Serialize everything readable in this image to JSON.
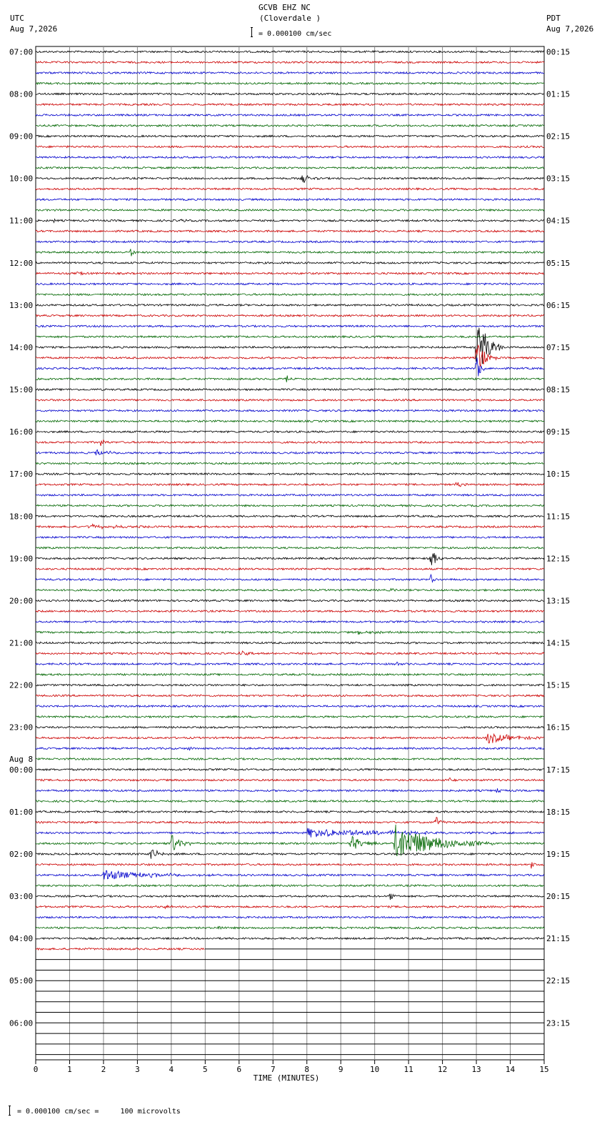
{
  "header": {
    "station": "GCVB EHZ NC",
    "location": "(Cloverdale )",
    "left_tz": "UTC",
    "left_date": "Aug 7,2026",
    "right_tz": "PDT",
    "right_date": "Aug 7,2026",
    "scale": "= 0.000100 cm/sec"
  },
  "footer": {
    "scale_note": "= 0.000100 cm/sec =     100 microvolts"
  },
  "colors": [
    "#000000",
    "#cc0000",
    "#0000cc",
    "#006600"
  ],
  "chart_data": {
    "type": "line",
    "xlabel": "TIME (MINUTES)",
    "xlim": [
      0,
      15
    ],
    "x_ticks": [
      "0",
      "1",
      "2",
      "3",
      "4",
      "5",
      "6",
      "7",
      "8",
      "9",
      "10",
      "11",
      "12",
      "13",
      "14",
      "15"
    ],
    "rows_total": 96,
    "rows_with_data": 86,
    "last_row_fraction": 0.333,
    "date_change_label": "Aug 8",
    "date_change_row": 68,
    "left_labels": [
      "07:00",
      "08:00",
      "09:00",
      "10:00",
      "11:00",
      "12:00",
      "13:00",
      "14:00",
      "15:00",
      "16:00",
      "17:00",
      "18:00",
      "19:00",
      "20:00",
      "21:00",
      "22:00",
      "23:00",
      "00:00",
      "01:00",
      "02:00",
      "03:00",
      "04:00",
      "05:00",
      "06:00"
    ],
    "right_labels": [
      "00:15",
      "01:15",
      "02:15",
      "03:15",
      "04:15",
      "05:15",
      "06:15",
      "07:15",
      "08:15",
      "09:15",
      "10:15",
      "11:15",
      "12:15",
      "13:15",
      "14:15",
      "15:15",
      "16:15",
      "17:15",
      "18:15",
      "19:15",
      "20:15",
      "21:15",
      "22:15",
      "23:15"
    ],
    "events": [
      {
        "row": 12,
        "minute": 7.85,
        "amp": 9,
        "dur": 0.5
      },
      {
        "row": 16,
        "minute": 0.55,
        "amp": 4,
        "dur": 0.1
      },
      {
        "row": 16,
        "minute": 4.3,
        "amp": 3,
        "dur": 0.3
      },
      {
        "row": 19,
        "minute": 2.8,
        "amp": 9,
        "dur": 0.2
      },
      {
        "row": 21,
        "minute": 1.2,
        "amp": 3,
        "dur": 0.5
      },
      {
        "row": 28,
        "minute": 13.0,
        "amp": 50,
        "dur": 0.8
      },
      {
        "row": 29,
        "minute": 13.0,
        "amp": 30,
        "dur": 0.6
      },
      {
        "row": 30,
        "minute": 13.0,
        "amp": 25,
        "dur": 0.3
      },
      {
        "row": 31,
        "minute": 7.4,
        "amp": 9,
        "dur": 0.2
      },
      {
        "row": 33,
        "minute": 1.0,
        "amp": 3,
        "dur": 0.3
      },
      {
        "row": 37,
        "minute": 1.95,
        "amp": 10,
        "dur": 0.2
      },
      {
        "row": 38,
        "minute": 1.8,
        "amp": 5,
        "dur": 1.0
      },
      {
        "row": 41,
        "minute": 12.4,
        "amp": 5,
        "dur": 0.4
      },
      {
        "row": 45,
        "minute": 1.5,
        "amp": 3,
        "dur": 3.0
      },
      {
        "row": 48,
        "minute": 11.65,
        "amp": 18,
        "dur": 0.4
      },
      {
        "row": 50,
        "minute": 11.65,
        "amp": 8,
        "dur": 0.2
      },
      {
        "row": 51,
        "minute": 10.5,
        "amp": 3,
        "dur": 0.3
      },
      {
        "row": 55,
        "minute": 9.5,
        "amp": 3,
        "dur": 1.5
      },
      {
        "row": 57,
        "minute": 6.0,
        "amp": 4,
        "dur": 0.6
      },
      {
        "row": 58,
        "minute": 10.65,
        "amp": 5,
        "dur": 0.2
      },
      {
        "row": 65,
        "minute": 13.3,
        "amp": 8,
        "dur": 2.0
      },
      {
        "row": 66,
        "minute": 4.5,
        "amp": 4,
        "dur": 0.2
      },
      {
        "row": 69,
        "minute": 12.2,
        "amp": 3,
        "dur": 0.3
      },
      {
        "row": 70,
        "minute": 13.6,
        "amp": 4,
        "dur": 0.3
      },
      {
        "row": 73,
        "minute": 11.8,
        "amp": 10,
        "dur": 0.3
      },
      {
        "row": 74,
        "minute": 8.0,
        "amp": 6,
        "dur": 7.0
      },
      {
        "row": 75,
        "minute": 10.6,
        "amp": 28,
        "dur": 3.0
      },
      {
        "row": 75,
        "minute": 4.0,
        "amp": 14,
        "dur": 0.8
      },
      {
        "row": 75,
        "minute": 9.3,
        "amp": 12,
        "dur": 1.0
      },
      {
        "row": 76,
        "minute": 3.4,
        "amp": 8,
        "dur": 0.6
      },
      {
        "row": 77,
        "minute": 14.6,
        "amp": 6,
        "dur": 0.3
      },
      {
        "row": 78,
        "minute": 2.0,
        "amp": 7,
        "dur": 4.0
      },
      {
        "row": 80,
        "minute": 10.45,
        "amp": 8,
        "dur": 0.3
      },
      {
        "row": 81,
        "minute": 3.8,
        "amp": 3,
        "dur": 0.5
      },
      {
        "row": 83,
        "minute": 5.4,
        "amp": 6,
        "dur": 0.2
      }
    ]
  }
}
